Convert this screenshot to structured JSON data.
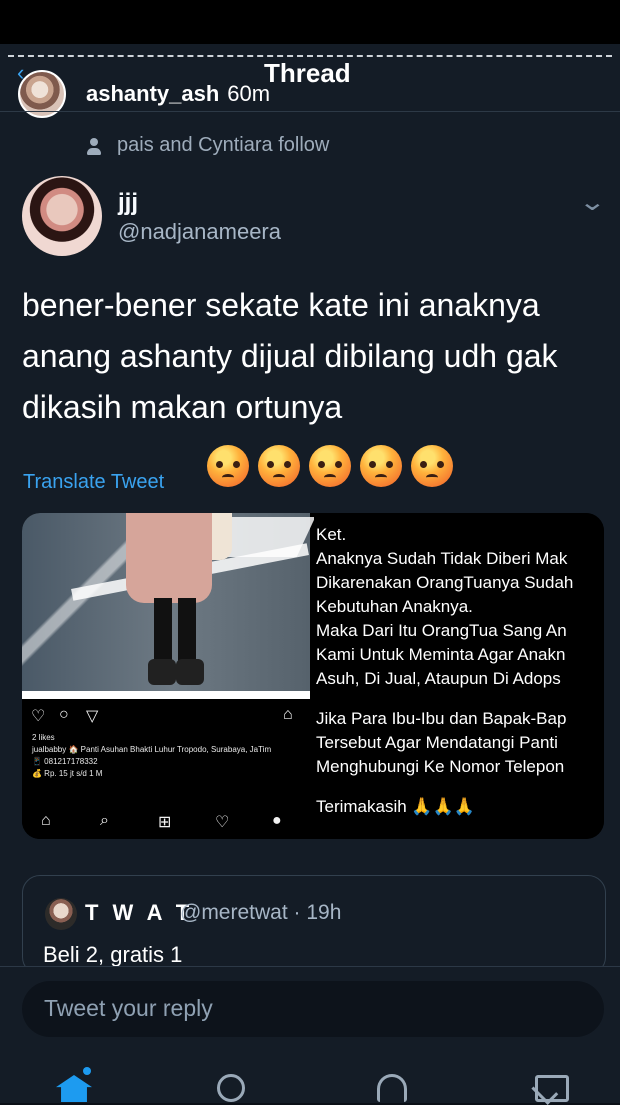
{
  "story": {
    "title": "Thread",
    "username": "ashanty_ash",
    "time": "60m"
  },
  "tweet": {
    "social_context": "pais and Cyntiara follow",
    "author_name": "jjj",
    "author_handle": "@nadjanameera",
    "lines": [
      "bener-bener sekate kate ini anaknya",
      "anang ashanty dijual dibilang udh gak",
      "dikasih makan ortunya"
    ],
    "translate_label": "Translate Tweet"
  },
  "media_left": {
    "likes": "2 likes",
    "caption": "jualbabby 🏠 Panti Asuhan Bhakti Luhur Tropodo, Surabaya, JaTim",
    "phone": "📱 081217178332",
    "price": "💰 Rp. 15 jt s/d 1 M"
  },
  "media_right": {
    "line1": "Ket.",
    "line2": "Anaknya Sudah Tidak Diberi Mak",
    "line3": "Dikarenakan OrangTuanya Sudah",
    "line4": "Kebutuhan Anaknya.",
    "line5": "Maka Dari Itu OrangTua Sang An",
    "line6": "Kami Untuk Meminta Agar Anakn",
    "line7": "Asuh, Di Jual, Ataupun Di Adops",
    "line8": "Jika Para Ibu-Ibu dan Bapak-Bap",
    "line9": "Tersebut Agar Mendatangi Panti",
    "line10": "Menghubungi Ke Nomor Telepon",
    "line11": "Terimakasih 🙏🙏🙏"
  },
  "quote": {
    "name": "T W A T",
    "handle_time": "@meretwat · 19h",
    "text": "Beli 2, gratis 1"
  },
  "reply": {
    "placeholder": "Tweet your reply"
  },
  "colors": {
    "background": "#141c26",
    "accent": "#1d9bf0",
    "secondary_text": "#9eacbb"
  },
  "icons": {
    "back": "chevron-left-icon",
    "follow_context": "person-icon",
    "menu": "chevron-down-icon",
    "emoji": "angry-face-icon",
    "home": "home-icon",
    "search": "search-icon",
    "notifications": "bell-icon",
    "messages": "mail-icon"
  }
}
